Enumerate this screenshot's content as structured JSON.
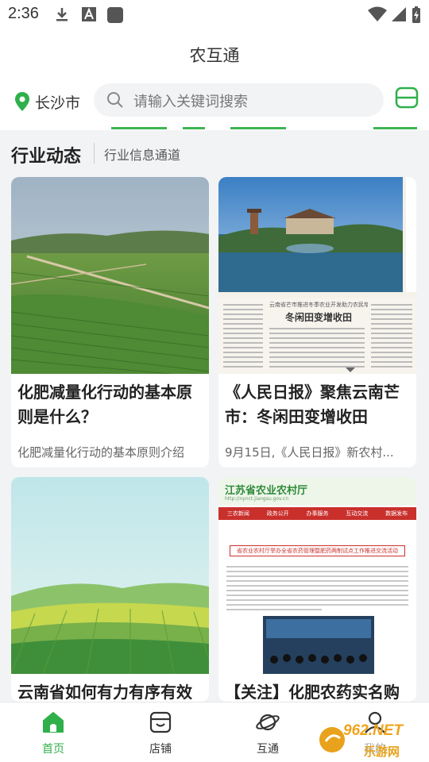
{
  "status_bar": {
    "time": "2:36",
    "icons": [
      "download-icon",
      "text-a-icon",
      "app-square-icon",
      "wifi-icon",
      "signal-icon",
      "battery-charging-icon"
    ]
  },
  "header": {
    "title": "农互通"
  },
  "search": {
    "city": "长沙市",
    "placeholder": "请输入关键词搜索",
    "location_icon": "location-pin-icon",
    "scan_icon": "scan-icon"
  },
  "section": {
    "title": "行业动态",
    "subtitle": "行业信息通道"
  },
  "cards": [
    {
      "title": "化肥减量化行动的基本原则是什么？",
      "desc": "化肥减量化行动的基本原则介绍",
      "image": "farmland-photo"
    },
    {
      "title": "《人民日报》聚焦云南芒市：冬闲田变增收田",
      "desc": "9月15日,《人民日报》新农村...",
      "image": "newspaper-clipping",
      "image_text": {
        "headline_top": "云南省芒市推进冬季农业开发助力农民增收",
        "headline": "冬闲田变增收田"
      }
    },
    {
      "title": "云南省如何有力有序有效",
      "desc": "",
      "image": "field-illustration"
    },
    {
      "title": "【关注】化肥农药实名购",
      "desc": "",
      "image": "government-webpage",
      "image_text": {
        "site_name": "江苏省农业农村厅",
        "site_url": "http://nynct.jiangsu.gov.cn",
        "nav_items": [
          "三农新闻",
          "政务公开",
          "办事服务",
          "互动交流",
          "数据发布"
        ],
        "article_title": "省农业农村厅举办全省农药管理暨肥药两制试点工作推进交流活动"
      }
    }
  ],
  "bottom_nav": [
    {
      "label": "首页",
      "icon": "home-icon",
      "active": true
    },
    {
      "label": "店铺",
      "icon": "shop-icon",
      "active": false
    },
    {
      "label": "互通",
      "icon": "planet-icon",
      "active": false
    },
    {
      "label": "我的",
      "icon": "user-icon",
      "active": false
    }
  ],
  "watermark": {
    "brand": "962.NET",
    "sub": "乐游网"
  },
  "colors": {
    "accent": "#2fb04b",
    "background": "#f2f3f5"
  }
}
